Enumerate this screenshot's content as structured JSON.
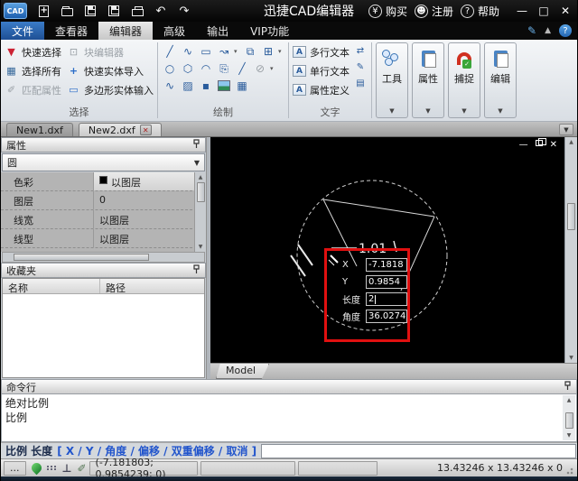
{
  "titlebar": {
    "app_title": "迅捷CAD编辑器",
    "buy_label": "购买",
    "register_label": "注册",
    "help_label": "帮助",
    "buy_symbol": "¥",
    "help_symbol": "?"
  },
  "menubar": {
    "tabs": [
      {
        "label": "文件"
      },
      {
        "label": "查看器"
      },
      {
        "label": "编辑器"
      },
      {
        "label": "高级"
      },
      {
        "label": "输出"
      },
      {
        "label": "VIP功能"
      }
    ]
  },
  "ribbon": {
    "select_group": {
      "label": "选择",
      "col1": [
        {
          "label": "快速选择"
        },
        {
          "label": "选择所有"
        },
        {
          "label": "匹配属性"
        }
      ],
      "col2": [
        {
          "label": "块编辑器"
        },
        {
          "label": "快速实体导入"
        },
        {
          "label": "多边形实体输入"
        }
      ]
    },
    "draw_group": {
      "label": "绘制"
    },
    "text_group": {
      "label": "文字",
      "items": [
        {
          "label": "多行文本"
        },
        {
          "label": "单行文本"
        },
        {
          "label": "属性定义"
        }
      ]
    },
    "big_buttons": [
      {
        "label": "工具"
      },
      {
        "label": "属性"
      },
      {
        "label": "捕捉"
      },
      {
        "label": "编辑"
      }
    ]
  },
  "doc_tabs": {
    "tab1": "New1.dxf",
    "tab2": "New2.dxf"
  },
  "properties_panel": {
    "title": "属性",
    "type_selector": "圆",
    "rows": [
      {
        "label": "色彩",
        "value": "以图层"
      },
      {
        "label": "图层",
        "value": "0"
      },
      {
        "label": "线宽",
        "value": "以图层"
      },
      {
        "label": "线型",
        "value": "以图层"
      }
    ]
  },
  "favorites_panel": {
    "title": "收藏夹",
    "col_name": "名称",
    "col_path": "路径"
  },
  "canvas": {
    "dim_label": "1.01",
    "tooltip": {
      "rows": [
        {
          "label": "X",
          "value": "-7.1818"
        },
        {
          "label": "Y",
          "value": "0.9854"
        },
        {
          "label": "长度",
          "value": "2"
        },
        {
          "label": "角度",
          "value": "36.0274"
        }
      ]
    },
    "model_tab": "Model"
  },
  "command_panel": {
    "title": "命令行",
    "lines": [
      "绝对比例",
      "比例"
    ],
    "prompt_label": "比例 长度",
    "prompt_options": "[ X / Y / 角度 / 偏移 / 双重偏移 / 取消 ]"
  },
  "statusbar": {
    "overflow": "...",
    "ortho_symbol": "⊥",
    "coordinates": "(-7.181803; 0.9854239; 0)",
    "size_info": "13.43246 x 13.43246 x 0"
  },
  "colors": {
    "accent_blue": "#2a6cc8",
    "annotation_red": "#e01010",
    "canvas_bg": "#000000"
  }
}
